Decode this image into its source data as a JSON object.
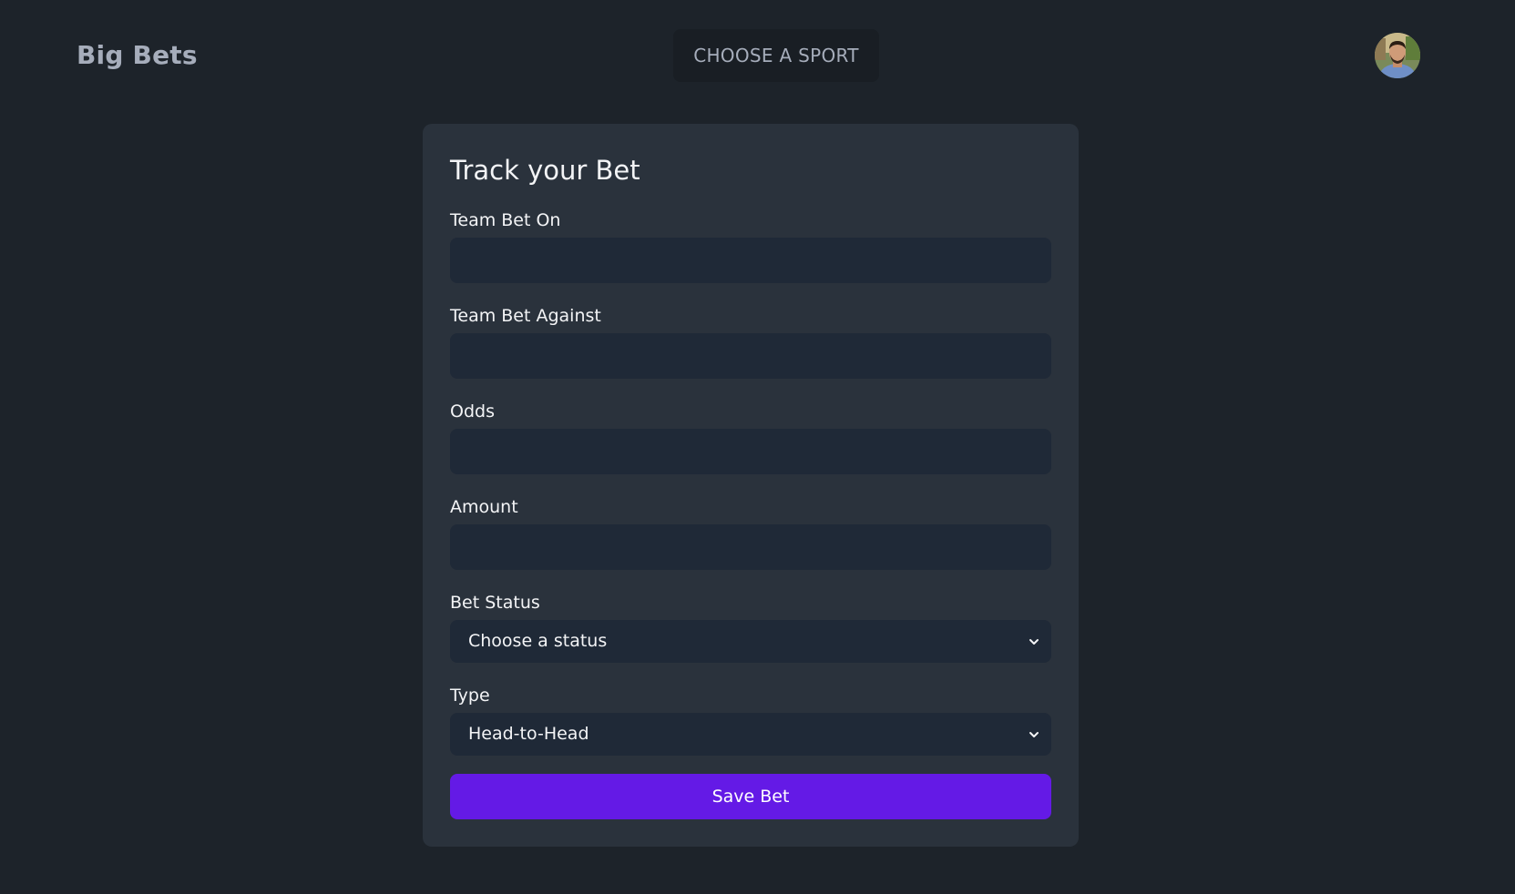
{
  "navbar": {
    "brand": "Big Bets",
    "sport_button": "CHOOSE A SPORT",
    "avatar_icon": "user-avatar-photo"
  },
  "form": {
    "title": "Track your Bet",
    "fields": {
      "team_bet_on": {
        "label": "Team Bet On",
        "value": "",
        "placeholder": ""
      },
      "team_bet_against": {
        "label": "Team Bet Against",
        "value": "",
        "placeholder": ""
      },
      "odds": {
        "label": "Odds",
        "value": "",
        "placeholder": ""
      },
      "amount": {
        "label": "Amount",
        "value": "",
        "placeholder": ""
      }
    },
    "bet_status": {
      "label": "Bet Status",
      "selected": "Choose a status"
    },
    "type": {
      "label": "Type",
      "selected": "Head-to-Head"
    },
    "save_button": "Save Bet"
  },
  "colors": {
    "page_bg": "#1d232a",
    "card_bg": "#2a323c",
    "input_bg": "#1f2937",
    "primary": "#641ae6",
    "muted_text": "#a6adbb"
  }
}
